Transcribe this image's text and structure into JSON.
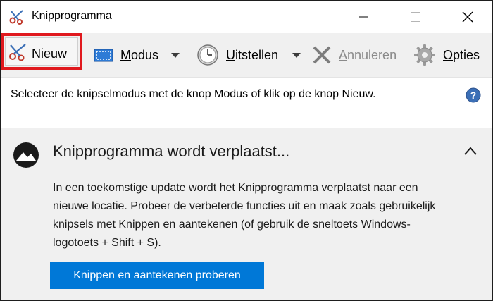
{
  "window": {
    "title": "Knipprogramma"
  },
  "toolbar": {
    "new": {
      "underline": "N",
      "rest": "ieuw"
    },
    "modus": {
      "underline": "M",
      "rest": "odus"
    },
    "uitstellen": {
      "underline": "U",
      "rest": "itstellen"
    },
    "annuleren": {
      "underline": "A",
      "rest": "nnuleren",
      "disabled": true
    },
    "opties": {
      "underline": "O",
      "rest": "pties"
    },
    "highlight_color": "#e0191e"
  },
  "info": {
    "text": "Selecteer de knipselmodus met de knop Modus of klik op de knop Nieuw."
  },
  "notice": {
    "title": "Knipprogramma wordt verplaatst...",
    "body": "In een toekomstige update wordt het Knipprogramma verplaatst naar een nieuwe locatie. Probeer de verbeterde functies uit en maak zoals gebruikelijk knipsels met Knippen en aantekenen (of gebruik de sneltoets Windows-logotoets + Shift + S).",
    "button_label": "Knippen en aantekenen proberen",
    "button_color": "#0078d7"
  },
  "icons": {
    "app": "scissors-icon",
    "new": "scissors-icon",
    "modus": "rectangle-select-icon",
    "uitstellen": "clock-icon",
    "annuleren": "x-icon",
    "opties": "gear-icon",
    "help": "help-icon",
    "notice": "snip-sketch-icon",
    "collapse": "chevron-up-icon"
  }
}
